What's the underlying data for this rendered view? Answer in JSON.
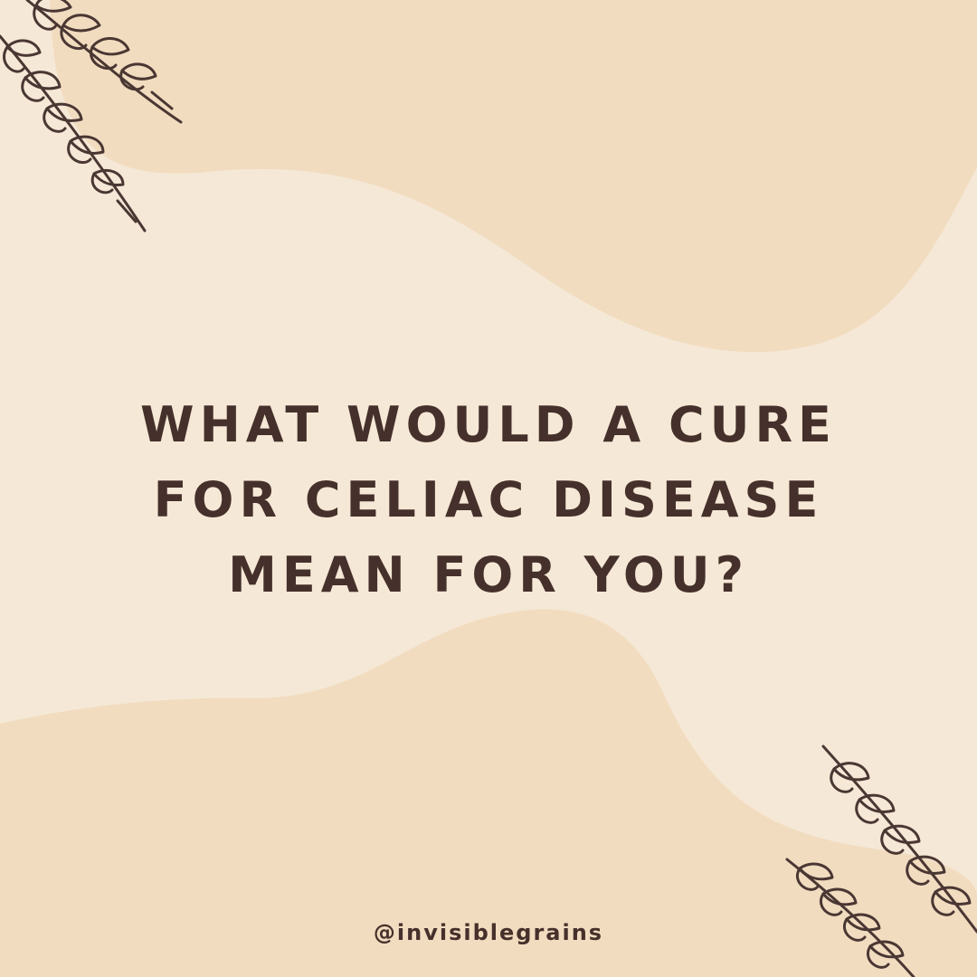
{
  "headline": {
    "line1": "What would a cure",
    "line2": "for Celiac disease",
    "line3": "mean for you?"
  },
  "handle": "@invisiblegrains",
  "colors": {
    "background": "#f5e8d6",
    "blob": "#f2dcc0",
    "text": "#45302b",
    "wheat_stroke": "#4a3733"
  },
  "decorations": {
    "top_left": "wheat-sprigs-icon",
    "bottom_right": "wheat-sprigs-icon"
  }
}
